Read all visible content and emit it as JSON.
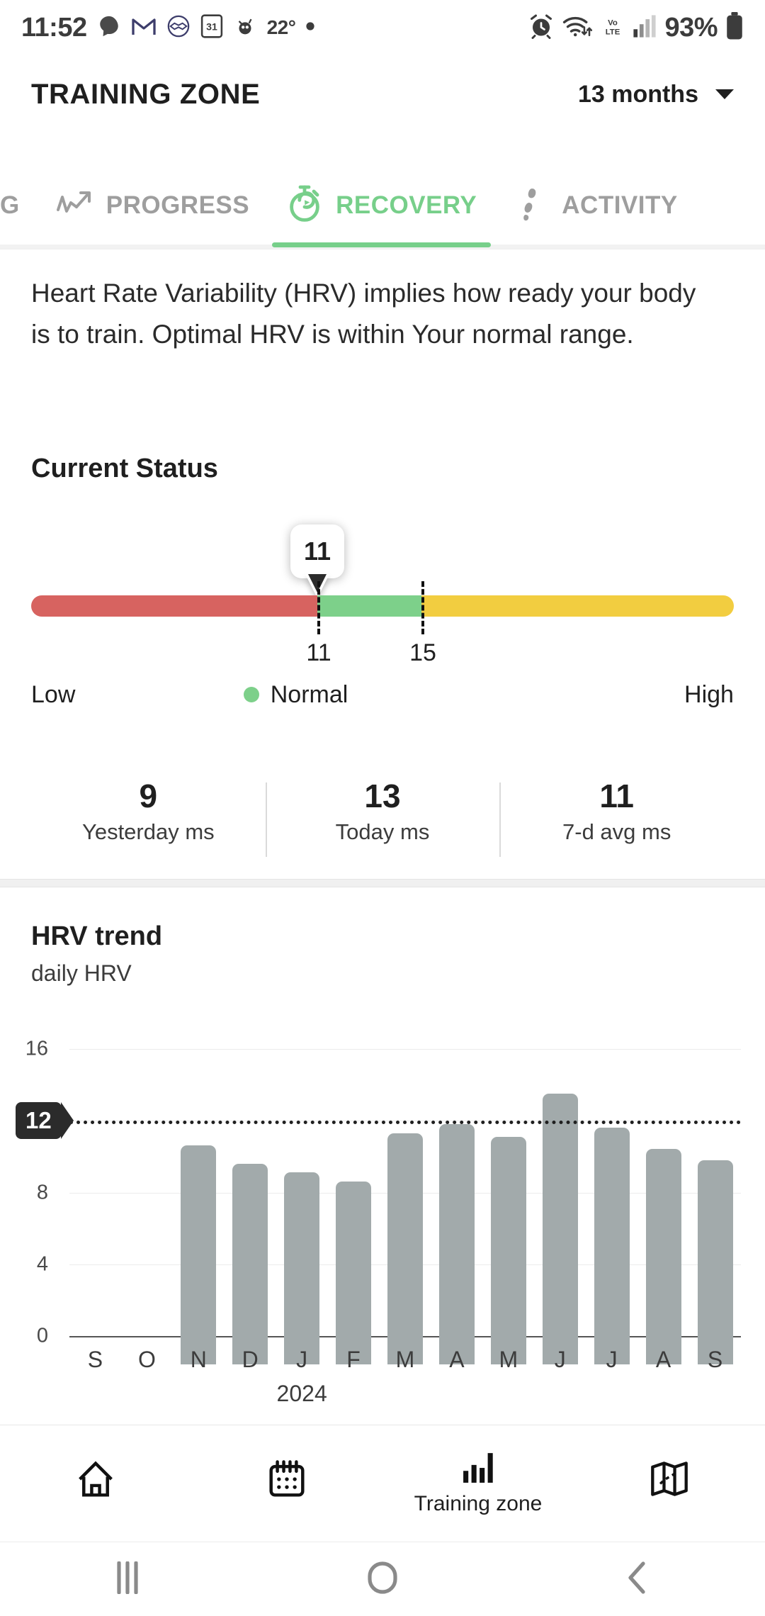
{
  "status_bar": {
    "time": "11:52",
    "battery_percent": "93%",
    "temperature": "22°",
    "left_icons": [
      "chat-bubble-icon",
      "gmail-icon",
      "handshake-icon",
      "calendar-31-icon",
      "emoji-icon",
      "weather-temp",
      "dot-icon"
    ],
    "right_icons": [
      "alarm-icon",
      "wifi-icon",
      "volte-icon",
      "signal-bars-icon",
      "battery-icon"
    ]
  },
  "header": {
    "title": "TRAINING ZONE",
    "range_label": "13 months",
    "caret_icon": "chevron-down-icon"
  },
  "tabs": [
    {
      "label": "G",
      "icon": "partial-tab",
      "active": false
    },
    {
      "label": "PROGRESS",
      "icon": "chart-line-up-icon",
      "active": false
    },
    {
      "label": "RECOVERY",
      "icon": "stopwatch-icon",
      "active": true
    },
    {
      "label": "ACTIVITY",
      "icon": "footsteps-icon",
      "active": false
    }
  ],
  "description": "Heart Rate Variability (HRV) implies how ready your body is to train. Optimal HRV is within Your normal range.",
  "current_status": {
    "title": "Current Status",
    "bubble_value": "11",
    "marker_value": 11,
    "low_threshold": "11",
    "high_threshold": "15",
    "scale_min": 0,
    "scale_max": 27,
    "segments": [
      {
        "name": "low",
        "color": "#d76360",
        "from": 0,
        "to": 11
      },
      {
        "name": "normal",
        "color": "#7dd08a",
        "from": 11,
        "to": 15
      },
      {
        "name": "high",
        "color": "#f2cd40",
        "from": 15,
        "to": 27
      }
    ],
    "legend": {
      "low": "Low",
      "normal": "Normal",
      "high": "High",
      "normal_dot_color": "#7dd08a"
    }
  },
  "stats": [
    {
      "value": "9",
      "label": "Yesterday ms"
    },
    {
      "value": "13",
      "label": "Today ms"
    },
    {
      "value": "11",
      "label": "7-d avg ms"
    }
  ],
  "trend": {
    "title": "HRV trend",
    "subtitle": "daily HRV",
    "year_label": "2024"
  },
  "chart_data": {
    "type": "bar",
    "title": "HRV trend",
    "subtitle": "daily HRV",
    "xlabel": "",
    "ylabel": "",
    "categories": [
      "S",
      "O",
      "N",
      "D",
      "J",
      "F",
      "M",
      "A",
      "M",
      "J",
      "J",
      "A",
      "S"
    ],
    "values": [
      null,
      null,
      12.2,
      11.2,
      10.7,
      10.2,
      12.9,
      13.4,
      12.7,
      15.1,
      13.2,
      12.0,
      11.4
    ],
    "ylim": [
      0,
      17
    ],
    "yticks": [
      0,
      4,
      8,
      12,
      16
    ],
    "ytick_labels": [
      "0",
      "4",
      "8",
      "12",
      "16"
    ],
    "grid": true,
    "bar_color": "#a2aaab",
    "reference_line": {
      "value": 12,
      "label": "12",
      "style": "dotted",
      "color": "#1f1f1f"
    },
    "year_annotation": {
      "text": "2024",
      "at_category": "J"
    },
    "legend": null
  },
  "bottom_nav": [
    {
      "icon": "home-icon",
      "label": ""
    },
    {
      "icon": "calendar-icon",
      "label": ""
    },
    {
      "icon": "bar-chart-icon",
      "label": "Training zone",
      "active": true
    },
    {
      "icon": "map-icon",
      "label": ""
    }
  ],
  "android_nav": [
    {
      "icon": "recent-apps-icon"
    },
    {
      "icon": "home-circle-icon"
    },
    {
      "icon": "back-chevron-icon"
    }
  ]
}
